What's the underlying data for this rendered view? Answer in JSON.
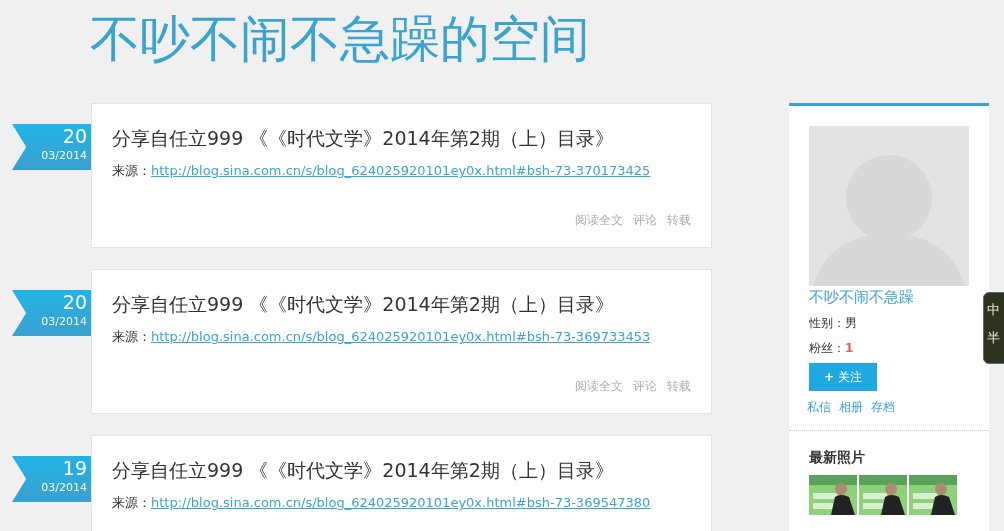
{
  "blog_title": "不吵不闹不急躁的空间",
  "posts": [
    {
      "day": "20",
      "month": "03/2014",
      "title": "分享自任立999 《《时代文学》2014年第2期（上）目录》",
      "source_label": "来源：",
      "source_url": "http://blog.sina.com.cn/s/blog_624025920101ey0x.html#bsh-73-370173425",
      "actions": [
        "阅读全文",
        "评论",
        "转载"
      ]
    },
    {
      "day": "20",
      "month": "03/2014",
      "title": "分享自任立999 《《时代文学》2014年第2期（上）目录》",
      "source_label": "来源：",
      "source_url": "http://blog.sina.com.cn/s/blog_624025920101ey0x.html#bsh-73-369733453",
      "actions": [
        "阅读全文",
        "评论",
        "转载"
      ]
    },
    {
      "day": "19",
      "month": "03/2014",
      "title": "分享自任立999 《《时代文学》2014年第2期（上）目录》",
      "source_label": "来源：",
      "source_url": "http://blog.sina.com.cn/s/blog_624025920101ey0x.html#bsh-73-369547380"
    }
  ],
  "profile": {
    "name": "不吵不闹不急躁",
    "gender_label": "性别：",
    "gender": "男",
    "fans_label": "粉丝：",
    "fans": "1",
    "follow_icon": "+",
    "follow_button": "关注",
    "links": [
      "私信",
      "相册",
      "存档"
    ]
  },
  "photos": {
    "heading": "最新照片"
  },
  "side_widget": [
    "中",
    "半"
  ]
}
